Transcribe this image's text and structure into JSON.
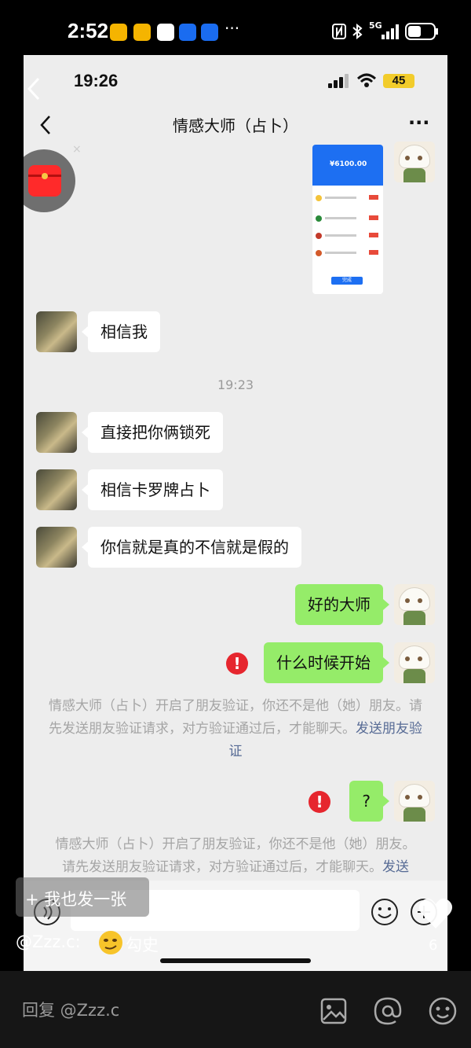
{
  "outer_status": {
    "time": "2:52",
    "dots": "···",
    "network": "5G"
  },
  "inner_status": {
    "time": "19:26",
    "battery": "45"
  },
  "chat": {
    "title": "情感大师（占卜）",
    "more": "···",
    "receipt": {
      "amount": "¥6100.00",
      "button": "完成"
    },
    "messages": [
      {
        "text": "相信我"
      },
      {
        "text": "直接把你俩锁死"
      },
      {
        "text": "相信卡罗牌占卜"
      },
      {
        "text": "你信就是真的不信就是假的"
      },
      {
        "text": "好的大师"
      },
      {
        "text": "什么时候开始"
      },
      {
        "text": "?"
      }
    ],
    "timestamp": "19:23",
    "error_mark": "!",
    "system_notice": {
      "text": "情感大师（占卜）开启了朋友验证，你还不是他（她）朋友。请先发送朋友验证请求，对方验证通过后，才能聊天。",
      "link": "发送朋友验证"
    },
    "system_notice_2": {
      "line1": "情感大师（占卜）开启了朋友验证，你还不是他（她）朋友。",
      "line2": "请先发送朋友验证请求，对方验证通过后，才能聊天。",
      "link": "发送"
    }
  },
  "overlay": {
    "post_button": "+ 我也发一张",
    "comment_user": "@Zzz.c:",
    "comment_text": "勾史",
    "like_count": "6"
  },
  "reply_bar": {
    "placeholder": "回复 @Zzz.c"
  },
  "colors": {
    "chat_bg": "#ededed",
    "bubble_self": "#95ec69",
    "bubble_other": "#ffffff",
    "error": "#e6262e",
    "link": "#576b95"
  }
}
